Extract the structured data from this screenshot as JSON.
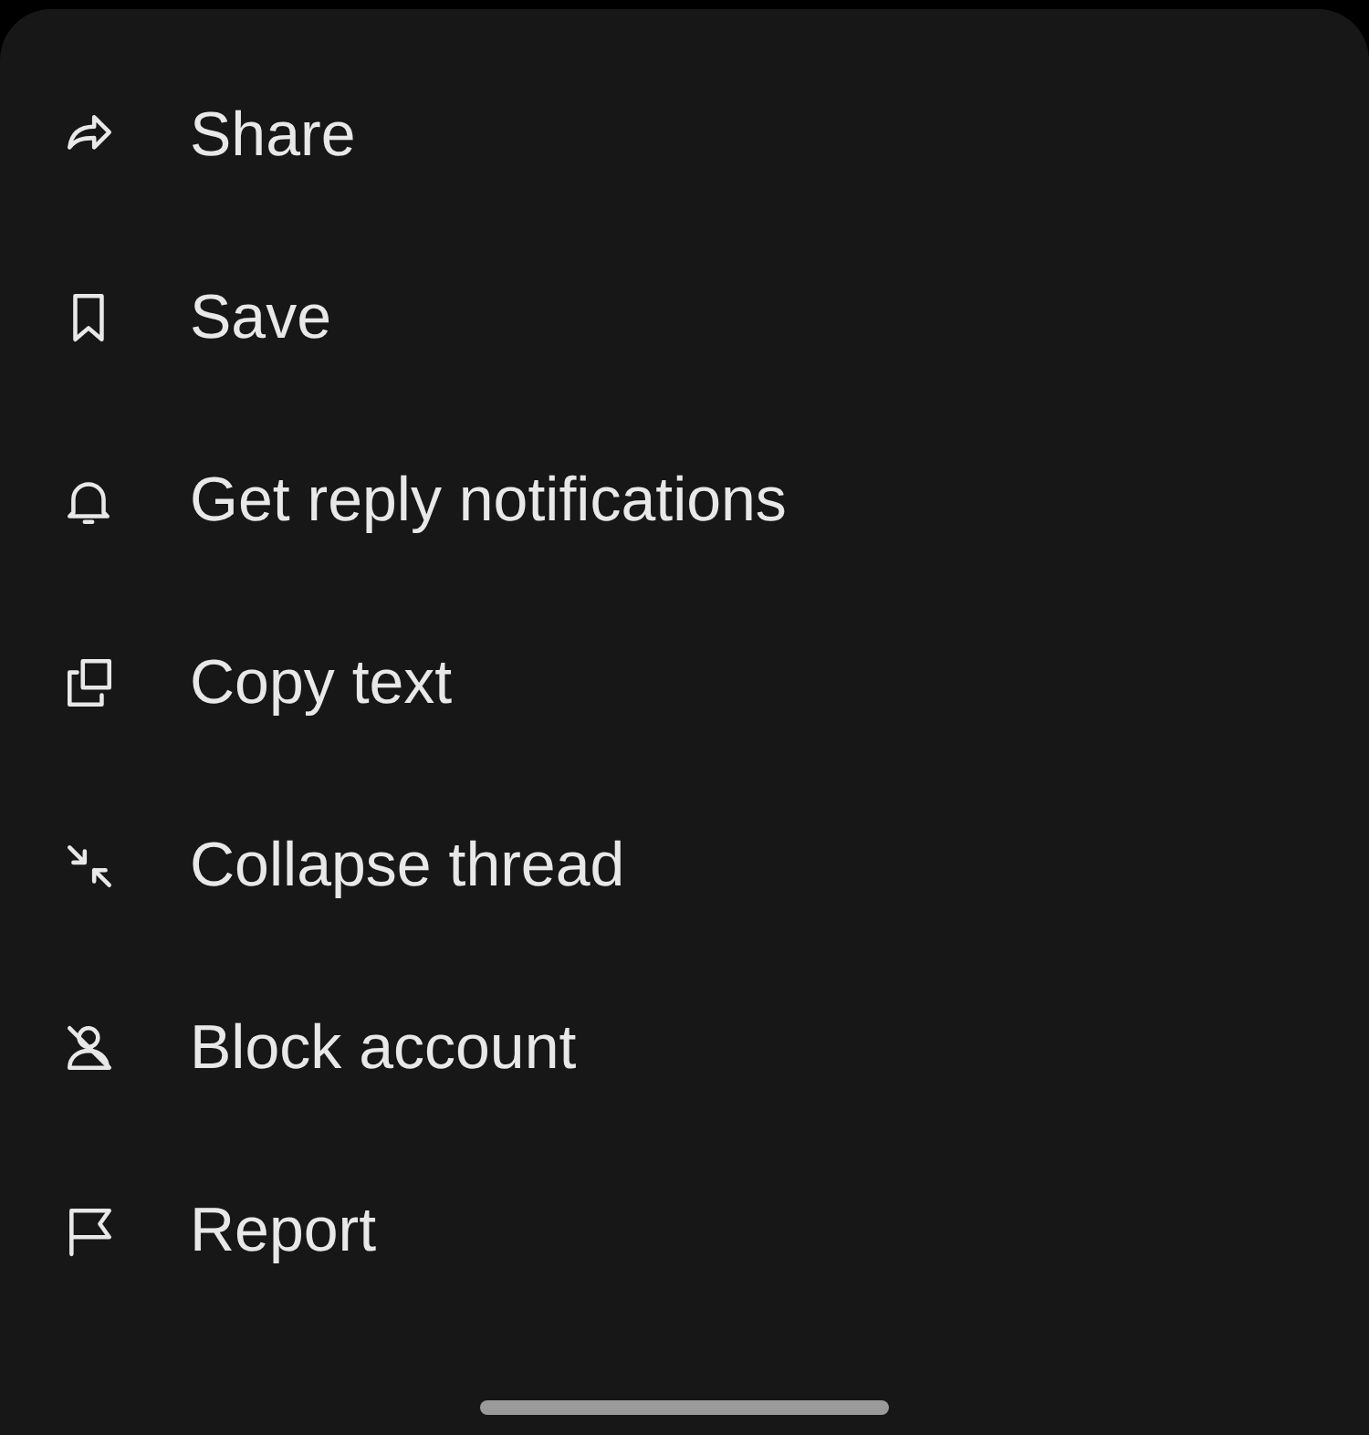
{
  "menu": {
    "items": [
      {
        "kind": "share",
        "label": "Share"
      },
      {
        "kind": "save",
        "label": "Save"
      },
      {
        "kind": "notify",
        "label": "Get reply notifications"
      },
      {
        "kind": "copy",
        "label": "Copy text"
      },
      {
        "kind": "collapse",
        "label": "Collapse thread"
      },
      {
        "kind": "block",
        "label": "Block account"
      },
      {
        "kind": "report",
        "label": "Report"
      }
    ]
  }
}
